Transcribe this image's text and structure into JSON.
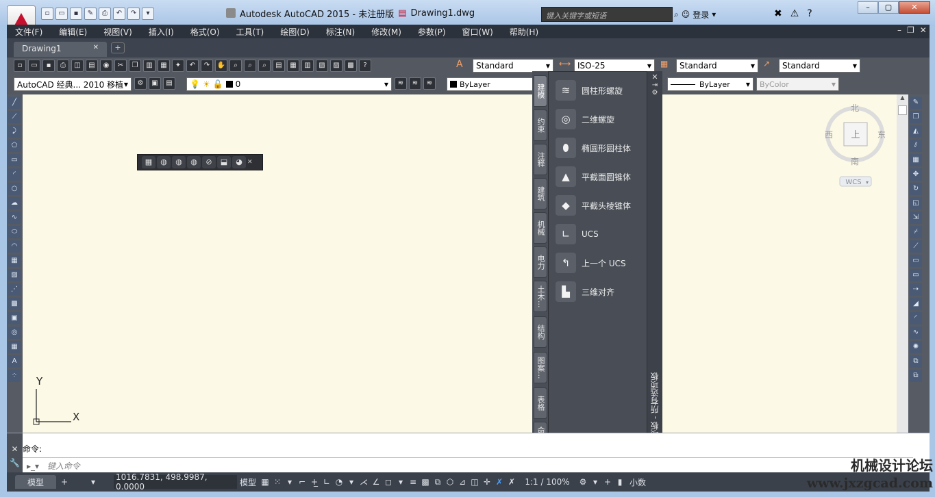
{
  "app": {
    "title": "Autodesk AutoCAD 2015 - 未注册版",
    "file": "Drawing1.dwg",
    "search_placeholder": "键入关键字或短语",
    "login_label": "登录",
    "accent": "#c8102e"
  },
  "menubar": {
    "items": [
      "文件(F)",
      "编辑(E)",
      "视图(V)",
      "插入(I)",
      "格式(O)",
      "工具(T)",
      "绘图(D)",
      "标注(N)",
      "修改(M)",
      "参数(P)",
      "窗口(W)",
      "帮助(H)"
    ]
  },
  "document_tab": {
    "label": "Drawing1"
  },
  "styles": {
    "text_style": "Standard",
    "dim_style": "ISO-25",
    "table_style": "Standard",
    "multileader_style": "Standard"
  },
  "workspace": {
    "label": "AutoCAD 经典... 2010 移植"
  },
  "layer": {
    "current": "0"
  },
  "properties": {
    "color": "ByLayer",
    "linetype": "ByLayer",
    "plotstyle": "ByColor"
  },
  "tool_palette": {
    "tabs": [
      "建模",
      "约束",
      "注释",
      "建筑",
      "机械",
      "电力",
      "土木...",
      "结构",
      "图案...",
      "表格",
      "命令..."
    ],
    "active_tab": "建模",
    "items": [
      "圆柱形螺旋",
      "二维螺旋",
      "椭圆形圆柱体",
      "平截面圆锥体",
      "平截头棱锥体",
      "UCS",
      "上一个 UCS",
      "三维对齐"
    ],
    "vertical_title": "工具选项板 - 所有选项板"
  },
  "viewcube": {
    "north": "北",
    "south": "南",
    "east": "东",
    "west": "西",
    "face": "上",
    "wcs": "WCS"
  },
  "ucs": {
    "x": "X",
    "y": "Y"
  },
  "command": {
    "history": "命令:",
    "placeholder": "键入命令"
  },
  "status": {
    "model_tab": "模型",
    "coordinates": "1016.7831, 498.9987, 0.0000",
    "space": "模型",
    "scale": "1:1 / 100%",
    "units": "小数"
  },
  "watermark": {
    "line1": "机械设计论坛",
    "line2": "www.jxzgcad.com"
  }
}
